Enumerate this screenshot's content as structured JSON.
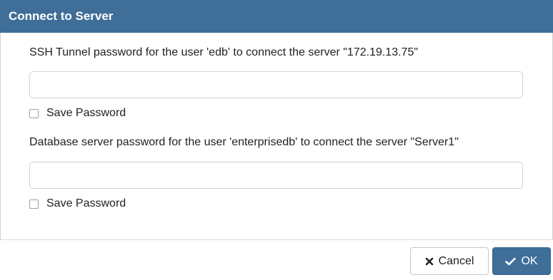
{
  "dialog": {
    "title": "Connect to Server",
    "ssh": {
      "prompt": "SSH Tunnel password for the user 'edb' to connect the server \"172.19.13.75\"",
      "password_value": "",
      "save_label": "Save Password",
      "save_checked": false
    },
    "db": {
      "prompt": "Database server password for the user 'enterprisedb' to connect the server \"Server1\"",
      "password_value": "",
      "save_label": "Save Password",
      "save_checked": false
    },
    "buttons": {
      "cancel_label": "Cancel",
      "cancel_icon": "close-icon",
      "ok_label": "OK",
      "ok_icon": "check-icon"
    },
    "colors": {
      "titlebar": "#3f6e99",
      "ok_button": "#3f6e99"
    }
  }
}
